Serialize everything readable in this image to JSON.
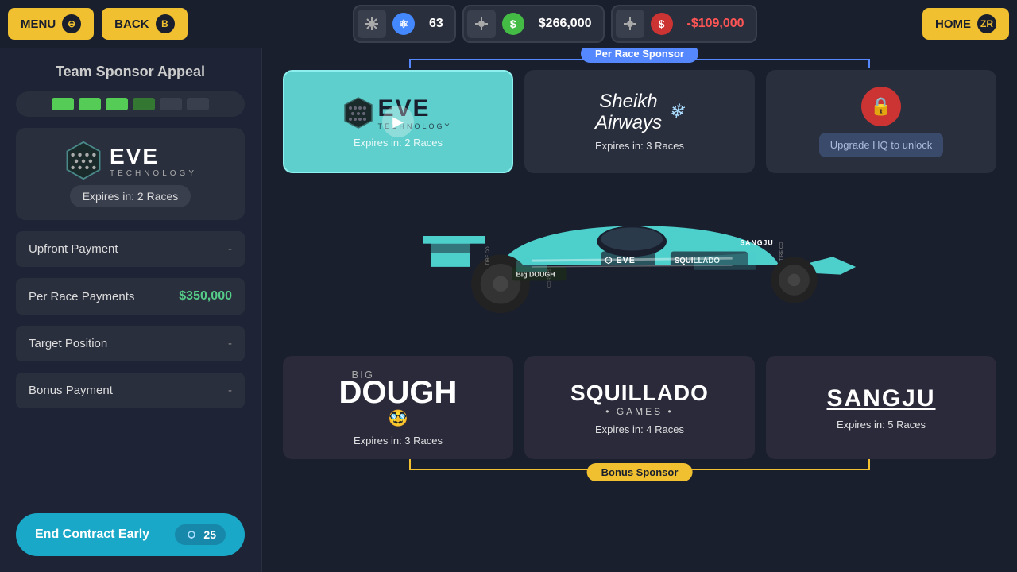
{
  "topBar": {
    "menu_label": "MENU",
    "menu_badge": "⊖",
    "back_label": "BACK",
    "back_badge": "B",
    "stat1_icon": "⚙",
    "stat1_value": "63",
    "stat2_icon": "$",
    "stat2_value": "$266,000",
    "stat3_icon": "$",
    "stat3_value": "-$109,000",
    "home_label": "HOME",
    "home_badge": "ZR"
  },
  "sidebar": {
    "title": "Team Sponsor Appeal",
    "sponsor_name": "EVE TECHNOLOGY",
    "expires_text": "Expires in: 2 Races",
    "upfront_label": "Upfront Payment",
    "upfront_value": "-",
    "per_race_label": "Per Race Payments",
    "per_race_value": "$350,000",
    "target_label": "Target Position",
    "target_value": "-",
    "bonus_label": "Bonus Payment",
    "bonus_value": "-",
    "end_contract_label": "End Contract Early",
    "end_contract_cost": "25"
  },
  "perRaceLabel": "Per Race Sponsor",
  "bonusLabel": "Bonus Sponsor",
  "sponsors": {
    "top": [
      {
        "id": "eve",
        "name": "EVE TECHNOLOGY",
        "expires": "Expires in: 2 Races",
        "selected": true
      },
      {
        "id": "sheikh",
        "name": "Sheikh Airways",
        "expires": "Expires in: 3 Races",
        "selected": false
      },
      {
        "id": "locked",
        "name": "Upgrade HQ to unlock",
        "expires": "",
        "selected": false,
        "locked": true
      }
    ],
    "bottom": [
      {
        "id": "bigdough",
        "name": "BIG DOUGH",
        "expires": "Expires in: 3 Races"
      },
      {
        "id": "squillado",
        "name": "SQUILLADO GAMES",
        "expires": "Expires in: 4 Races"
      },
      {
        "id": "sangju",
        "name": "SANGJU",
        "expires": "Expires in: 5 Races"
      }
    ]
  },
  "colors": {
    "accent_blue": "#5588ff",
    "accent_teal": "#1aa8c8",
    "accent_gold": "#f0c030",
    "selected_teal": "#5ecfcc",
    "positive": "#55cc88"
  }
}
